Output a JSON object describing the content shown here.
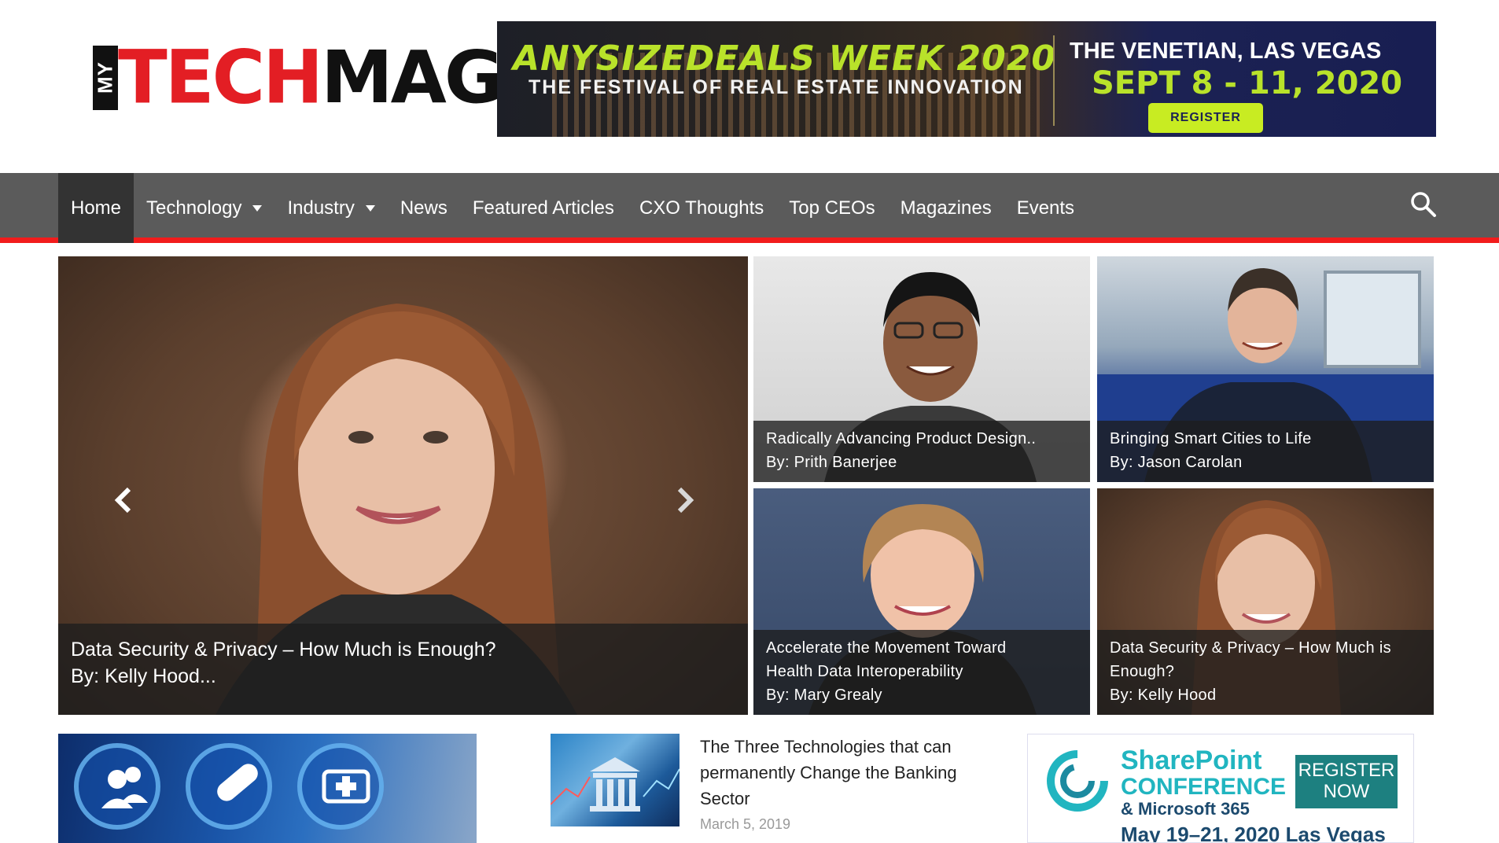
{
  "header": {
    "logo": {
      "my": "MY",
      "tech": "TECH",
      "mag": "MAG"
    },
    "banner": {
      "title": "ANYSIZEDEALS WEEK 2020",
      "subtitle": "THE FESTIVAL OF REAL ESTATE INNOVATION",
      "venue": "THE VENETIAN, LAS VEGAS",
      "dates": "SEPT 8 - 11, 2020",
      "button": "REGISTER"
    }
  },
  "nav": {
    "items": [
      {
        "label": "Home",
        "active": true
      },
      {
        "label": "Technology",
        "dropdown": true
      },
      {
        "label": "Industry",
        "dropdown": true
      },
      {
        "label": "News"
      },
      {
        "label": "Featured Articles"
      },
      {
        "label": "CXO Thoughts"
      },
      {
        "label": "Top CEOs"
      },
      {
        "label": "Magazines"
      },
      {
        "label": "Events"
      }
    ],
    "search_icon": "search-icon"
  },
  "hero": {
    "title": "Data Security & Privacy – How Much is Enough?",
    "byline": "By: Kelly Hood..."
  },
  "tiles": [
    {
      "title": "Radically Advancing Product Design..",
      "byline": "By: Prith Banerjee"
    },
    {
      "title": "Bringing Smart Cities to Life",
      "byline": "By: Jason Carolan"
    },
    {
      "title_1": "Accelerate the Movement Toward",
      "title_2": "Health Data Interoperability",
      "byline": "By: Mary Grealy"
    },
    {
      "title_1": "Data Security & Privacy – How Much is",
      "title_2": "Enough?",
      "byline": "By: Kelly Hood"
    }
  ],
  "articles": [
    {
      "title": "The Three Technologies that can permanently Change the Banking Sector",
      "date": "March 5, 2019"
    }
  ],
  "sidebar_ad": {
    "line1": "SharePoint",
    "line2": "CONFERENCE",
    "line3": "& Microsoft 365",
    "line4": "May 19–21, 2020   Las Vegas",
    "button_1": "REGISTER",
    "button_2": "NOW"
  },
  "colors": {
    "accent": "#f21c1c",
    "nav_bg": "#5b5b5b",
    "nav_active": "#333333"
  }
}
